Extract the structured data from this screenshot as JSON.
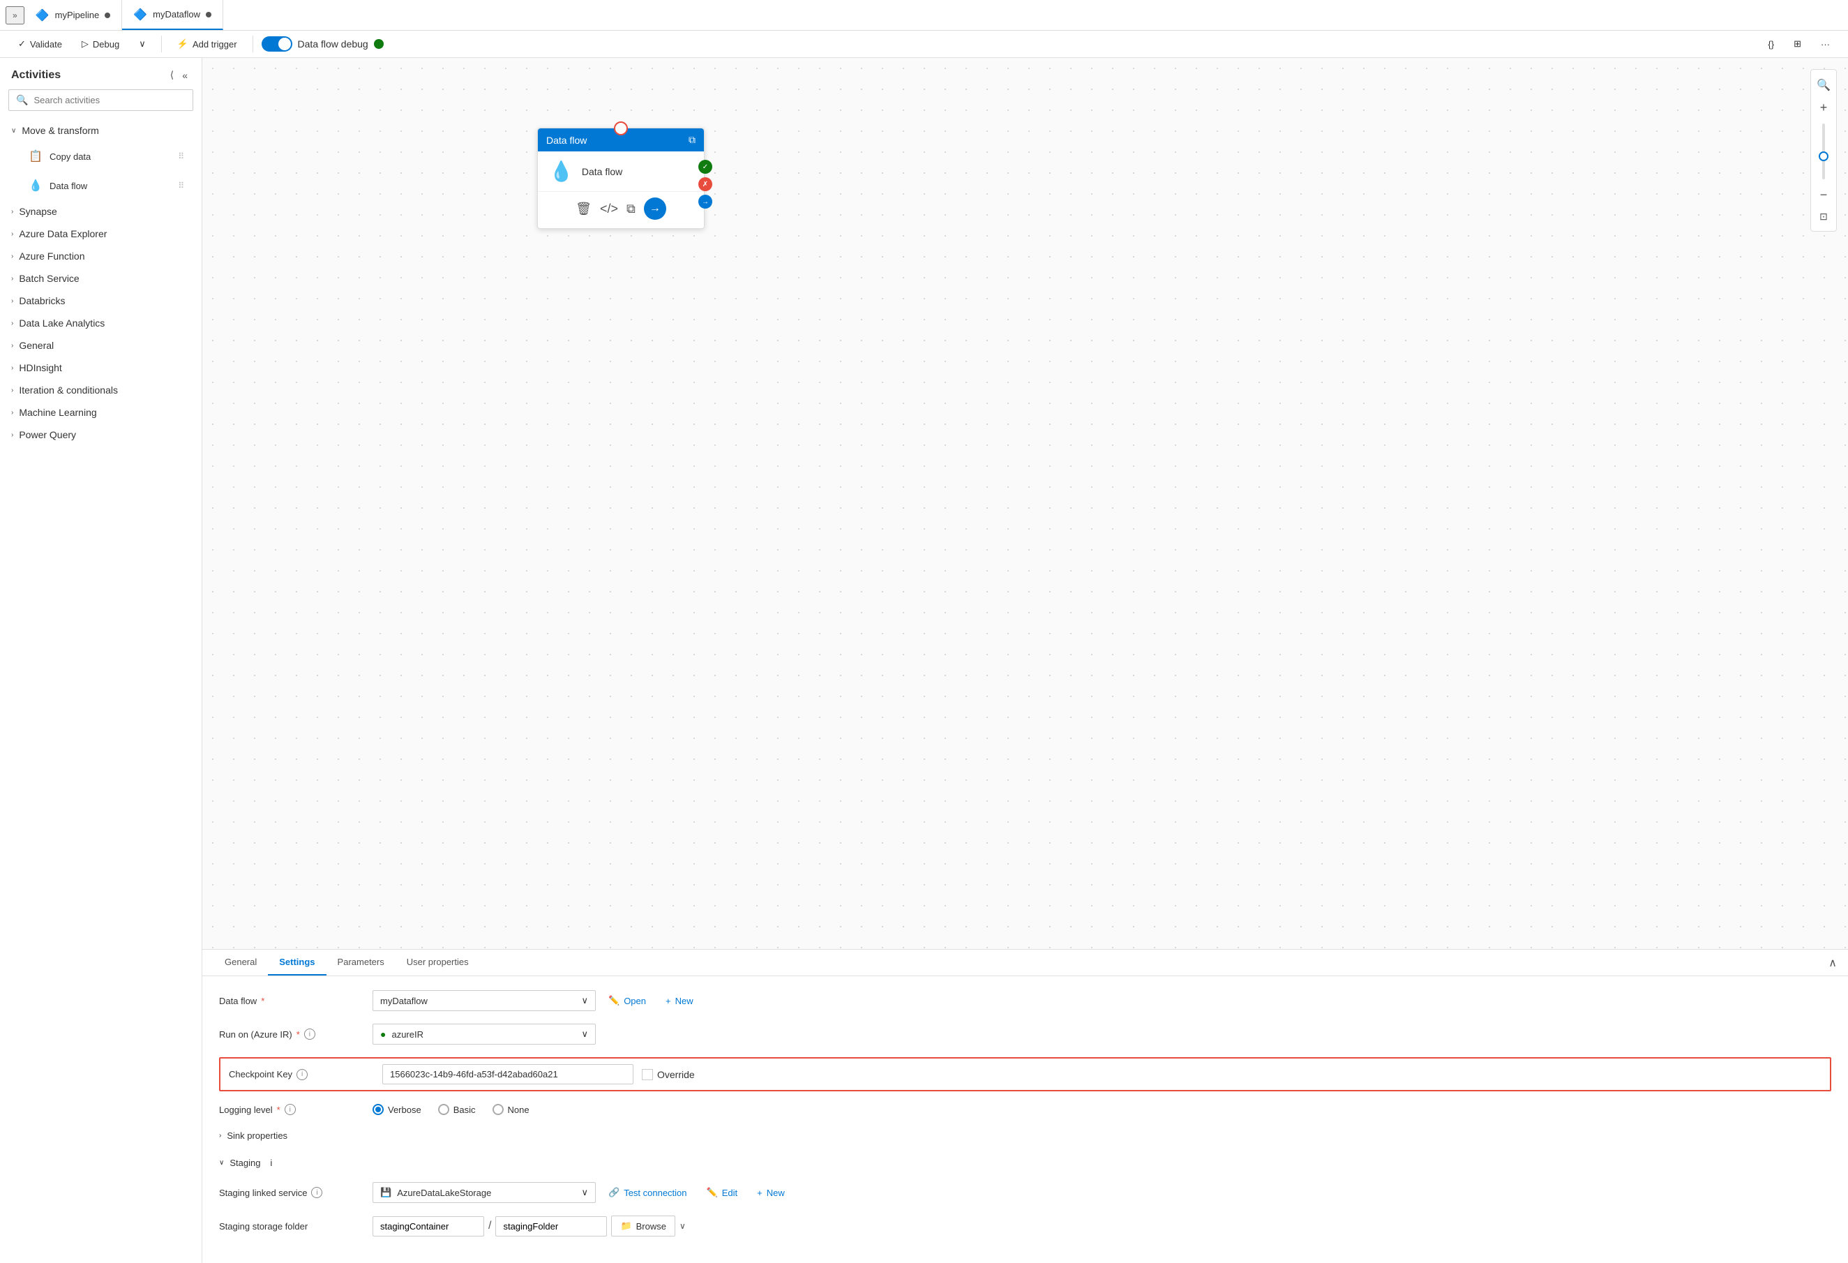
{
  "tabs": [
    {
      "id": "pipeline",
      "icon": "🔷",
      "label": "myPipeline",
      "hasDot": true
    },
    {
      "id": "dataflow",
      "icon": "🔷",
      "label": "myDataflow",
      "hasDot": true,
      "active": true
    }
  ],
  "toolbar": {
    "validate_label": "Validate",
    "debug_label": "Debug",
    "add_trigger_label": "Add trigger",
    "debug_toggle_label": "Data flow debug",
    "code_btn": "{}",
    "more_btn": "···"
  },
  "sidebar": {
    "title": "Activities",
    "search_placeholder": "Search activities",
    "categories": [
      {
        "id": "move-transform",
        "label": "Move & transform",
        "expanded": true,
        "items": [
          {
            "id": "copy-data",
            "icon": "📋",
            "label": "Copy data"
          },
          {
            "id": "data-flow",
            "icon": "💧",
            "label": "Data flow"
          }
        ]
      },
      {
        "id": "synapse",
        "label": "Synapse",
        "expanded": false
      },
      {
        "id": "azure-data-explorer",
        "label": "Azure Data Explorer",
        "expanded": false
      },
      {
        "id": "azure-function",
        "label": "Azure Function",
        "expanded": false
      },
      {
        "id": "batch-service",
        "label": "Batch Service",
        "expanded": false
      },
      {
        "id": "databricks",
        "label": "Databricks",
        "expanded": false
      },
      {
        "id": "data-lake-analytics",
        "label": "Data Lake Analytics",
        "expanded": false
      },
      {
        "id": "general",
        "label": "General",
        "expanded": false
      },
      {
        "id": "hdinsight",
        "label": "HDInsight",
        "expanded": false
      },
      {
        "id": "iteration-conditionals",
        "label": "Iteration & conditionals",
        "expanded": false
      },
      {
        "id": "machine-learning",
        "label": "Machine Learning",
        "expanded": false
      },
      {
        "id": "power-query",
        "label": "Power Query",
        "expanded": false
      }
    ]
  },
  "canvas": {
    "node": {
      "header": "Data flow",
      "body_label": "Data flow",
      "body_icon": "💧"
    }
  },
  "panel": {
    "tabs": [
      {
        "id": "general",
        "label": "General"
      },
      {
        "id": "settings",
        "label": "Settings",
        "active": true
      },
      {
        "id": "parameters",
        "label": "Parameters"
      },
      {
        "id": "user-properties",
        "label": "User properties"
      }
    ],
    "settings": {
      "dataflow_label": "Data flow",
      "dataflow_value": "myDataflow",
      "run_on_label": "Run on (Azure IR)",
      "run_on_value": "azureIR",
      "checkpoint_key_label": "Checkpoint Key",
      "checkpoint_key_value": "1566023c-14b9-46fd-a53f-d42abad60a21",
      "override_label": "Override",
      "logging_label": "Logging level",
      "logging_options": [
        "Verbose",
        "Basic",
        "None"
      ],
      "logging_selected": "Verbose",
      "sink_properties_label": "Sink properties",
      "staging_label": "Staging",
      "staging_linked_service_label": "Staging linked service",
      "staging_linked_service_value": "AzureDataLakeStorage",
      "staging_storage_folder_label": "Staging storage folder",
      "staging_container_value": "stagingContainer",
      "staging_folder_value": "stagingFolder",
      "open_label": "Open",
      "new_label": "New",
      "test_connection_label": "Test connection",
      "edit_label": "Edit",
      "browse_label": "Browse"
    }
  }
}
